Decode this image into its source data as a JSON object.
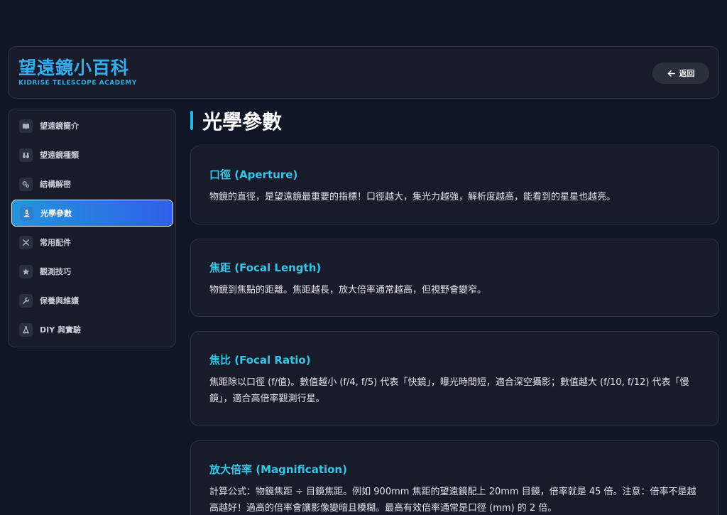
{
  "header": {
    "title": "望遠鏡小百科",
    "subtitle": "KIDRISE TELESCOPE ACADEMY",
    "back_label": "返回"
  },
  "sidebar": {
    "items": [
      {
        "label": "望遠鏡簡介",
        "icon": "book-icon"
      },
      {
        "label": "望遠鏡種類",
        "icon": "binoculars-icon"
      },
      {
        "label": "結構解密",
        "icon": "gears-icon"
      },
      {
        "label": "光學參數",
        "icon": "microscope-icon",
        "active": true
      },
      {
        "label": "常用配件",
        "icon": "tools-icon"
      },
      {
        "label": "觀測技巧",
        "icon": "star-icon"
      },
      {
        "label": "保養與維護",
        "icon": "wrench-icon"
      },
      {
        "label": "DIY 與實驗",
        "icon": "flask-icon"
      }
    ]
  },
  "main": {
    "title": "光學參數",
    "cards": [
      {
        "title": "口徑 (Aperture)",
        "body": "物鏡的直徑，是望遠鏡最重要的指標！口徑越大，集光力越強，解析度越高，能看到的星星也越亮。"
      },
      {
        "title": "焦距 (Focal Length)",
        "body": "物鏡到焦點的距離。焦距越長，放大倍率通常越高，但視野會變窄。"
      },
      {
        "title": "焦比 (Focal Ratio)",
        "body": "焦距除以口徑 (f/值)。數值越小 (f/4, f/5) 代表「快鏡」，曝光時間短，適合深空攝影；數值越大 (f/10, f/12) 代表「慢鏡」，適合高倍率觀測行星。"
      },
      {
        "title": "放大倍率 (Magnification)",
        "body": "計算公式：物鏡焦距 ÷ 目鏡焦距。例如 900mm 焦距的望遠鏡配上 20mm 目鏡，倍率就是 45 倍。注意：倍率不是越高越好！過高的倍率會讓影像變暗且模糊。最高有效倍率通常是口徑 (mm) 的 2 倍。"
      }
    ]
  },
  "colors": {
    "accent": "#34aef0",
    "card_title": "#38c6e8",
    "active_start": "#2494dc",
    "active_end": "#2f60e8"
  }
}
